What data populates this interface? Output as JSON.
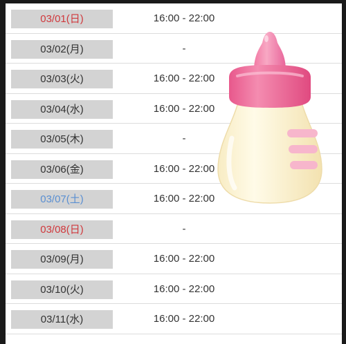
{
  "schedule": {
    "rows": [
      {
        "date": "03/01(日)",
        "time": "16:00 - 22:00",
        "day_type": "sun"
      },
      {
        "date": "03/02(月)",
        "time": "-",
        "day_type": "weekday"
      },
      {
        "date": "03/03(火)",
        "time": "16:00 - 22:00",
        "day_type": "weekday"
      },
      {
        "date": "03/04(水)",
        "time": "16:00 - 22:00",
        "day_type": "weekday"
      },
      {
        "date": "03/05(木)",
        "time": "-",
        "day_type": "weekday"
      },
      {
        "date": "03/06(金)",
        "time": "16:00 - 22:00",
        "day_type": "weekday"
      },
      {
        "date": "03/07(土)",
        "time": "16:00 - 22:00",
        "day_type": "sat"
      },
      {
        "date": "03/08(日)",
        "time": "-",
        "day_type": "sun"
      },
      {
        "date": "03/09(月)",
        "time": "16:00 - 22:00",
        "day_type": "weekday"
      },
      {
        "date": "03/10(火)",
        "time": "16:00 - 22:00",
        "day_type": "weekday"
      },
      {
        "date": "03/11(水)",
        "time": "16:00 - 22:00",
        "day_type": "weekday"
      }
    ]
  },
  "sticker": {
    "icon": "baby-bottle-icon"
  },
  "colors": {
    "sunday": "#d0383c",
    "saturday": "#5a8fd2",
    "date_bg": "#d3d3d3",
    "text": "#333333"
  }
}
